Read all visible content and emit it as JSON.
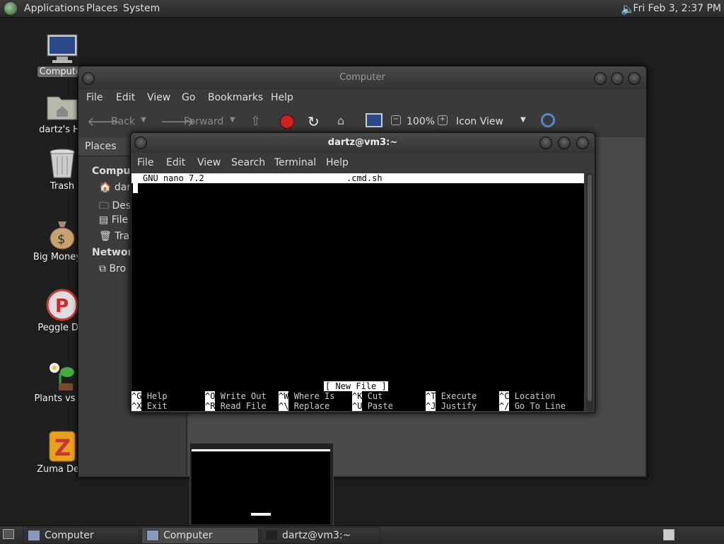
{
  "top_panel": {
    "menus": [
      "Applications",
      "Places",
      "System"
    ],
    "clock": "Fri Feb  3,  2:37 PM"
  },
  "desktop_icons": [
    {
      "label": "Computer",
      "icon": "computer-icon"
    },
    {
      "label": "dartz's Ho",
      "icon": "home-folder-icon"
    },
    {
      "label": "Trash",
      "icon": "trash-icon"
    },
    {
      "label": "Big Money D",
      "icon": "money-bag-icon"
    },
    {
      "label": "Peggle Del",
      "icon": "peggle-icon"
    },
    {
      "label": "Plants vs Zo",
      "icon": "plants-icon"
    },
    {
      "label": "Zuma Delu",
      "icon": "zuma-icon"
    }
  ],
  "file_manager": {
    "title": "Computer",
    "menus": [
      "File",
      "Edit",
      "View",
      "Go",
      "Bookmarks",
      "Help"
    ],
    "toolbar": {
      "back": "Back",
      "forward": "Forward",
      "zoom": "100%",
      "view_mode": "Icon View"
    },
    "sidebar": {
      "header": "Places",
      "sections": [
        {
          "title": "Comput",
          "items": [
            "dar",
            "Des",
            "File",
            "Tra"
          ]
        },
        {
          "title": "Network",
          "items": [
            "Bro"
          ]
        }
      ]
    }
  },
  "terminal": {
    "title": "dartz@vm3:~",
    "menus": [
      "File",
      "Edit",
      "View",
      "Search",
      "Terminal",
      "Help"
    ],
    "nano": {
      "version": "GNU nano 7.2",
      "filename": ".cmd.sh",
      "status": "[ New File ]",
      "shortcuts_row1": [
        {
          "key": "^G",
          "label": "Help"
        },
        {
          "key": "^O",
          "label": "Write Out"
        },
        {
          "key": "^W",
          "label": "Where Is"
        },
        {
          "key": "^K",
          "label": "Cut"
        },
        {
          "key": "^T",
          "label": "Execute"
        },
        {
          "key": "^C",
          "label": "Location"
        }
      ],
      "shortcuts_row2": [
        {
          "key": "^X",
          "label": "Exit"
        },
        {
          "key": "^R",
          "label": "Read File"
        },
        {
          "key": "^\\",
          "label": "Replace"
        },
        {
          "key": "^U",
          "label": "Paste"
        },
        {
          "key": "^J",
          "label": "Justify"
        },
        {
          "key": "^/",
          "label": "Go To Line"
        }
      ]
    }
  },
  "taskbar": [
    {
      "label": "Computer",
      "active": false
    },
    {
      "label": "Computer",
      "active": true
    },
    {
      "label": "dartz@vm3:~",
      "active": false
    }
  ]
}
